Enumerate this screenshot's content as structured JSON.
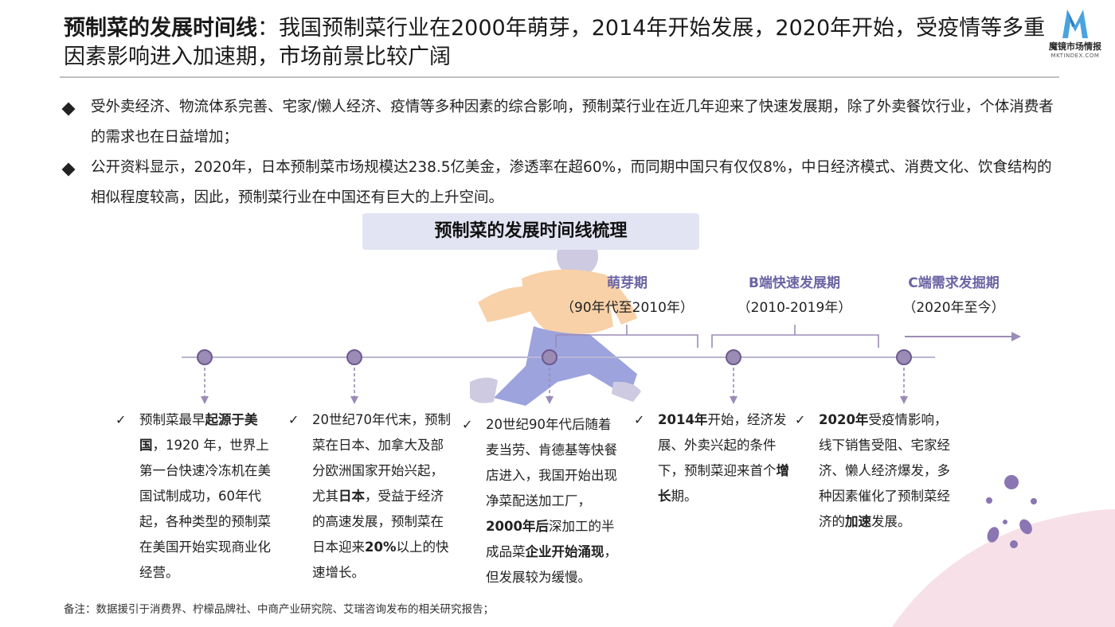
{
  "title": {
    "bold": "预制菜的发展时间线",
    "colon": "：",
    "rest": "我国预制菜行业在2000年萌芽，2014年开始发展，2020年开始，受疫情等多重因素影响进入加速期，市场前景比较广阔"
  },
  "logo": {
    "name": "魔镜市场情报",
    "sub": "MKTINDEX.COM"
  },
  "bullets": [
    {
      "text": "受外卖经济、物流体系完善、宅家/懒人经济、疫情等多种因素的综合影响，预制菜行业在近几年迎来了快速发展期，除了外卖餐饮行业，个体消费者的需求也在日益增加；"
    },
    {
      "text": "公开资料显示，2020年，日本预制菜市场规模达238.5亿美金，渗透率在超60%，而同期中国只有仅仅8%，中日经济模式、消费文化、饮食结构的相似程度较高，因此，预制菜行业在中国还有巨大的上升空间。"
    }
  ],
  "timeline_header": "预制菜的发展时间线梳理",
  "phases": [
    {
      "name": "萌芽期",
      "period": "（90年代至2010年）"
    },
    {
      "name": "B端快速发展期",
      "period": "（2010-2019年）"
    },
    {
      "name": "C端需求发掘期",
      "period": "（2020年至今）"
    }
  ],
  "cards": [
    {
      "check": "✓",
      "parts": [
        {
          "t": "预制菜最早",
          "b": false
        },
        {
          "t": "起源于美国",
          "b": true
        },
        {
          "t": "，1920 年，世界上第一台快速冷冻机在美国试制成功，60年代起，各种类型的预制菜在美国开始实现商业化经营。",
          "b": false
        }
      ]
    },
    {
      "check": "✓",
      "parts": [
        {
          "t": "20世纪70年代末，预制菜在日本、加拿大及部分欧洲国家开始兴起，尤其",
          "b": false
        },
        {
          "t": "日本",
          "b": true
        },
        {
          "t": "，受益于经济的高速发展，预制菜在日本迎来",
          "b": false
        },
        {
          "t": "20%",
          "b": true
        },
        {
          "t": "以上的快速增长。",
          "b": false
        }
      ]
    },
    {
      "check": "✓",
      "parts": [
        {
          "t": "20世纪90年代后随着麦当劳、肯德基等快餐店进入，我国开始出现净菜配送加工厂，",
          "b": false
        },
        {
          "t": "2000年后",
          "b": true
        },
        {
          "t": "深加工的半成品菜",
          "b": false
        },
        {
          "t": "企业开始涌现",
          "b": true
        },
        {
          "t": "，但发展较为缓慢。",
          "b": false
        }
      ]
    },
    {
      "check": "✓",
      "parts": [
        {
          "t": "2014年",
          "b": true
        },
        {
          "t": "开始，经济发展、外卖兴起的条件下，预制菜迎来首个",
          "b": false
        },
        {
          "t": "增长",
          "b": true
        },
        {
          "t": "期。",
          "b": false
        }
      ]
    },
    {
      "check": "✓",
      "parts": [
        {
          "t": "2020年",
          "b": true
        },
        {
          "t": "受疫情影响，线下销售受阻、宅家经济、懒人经济爆发，多种因素催化了预制菜经济的",
          "b": false
        },
        {
          "t": "加速",
          "b": true
        },
        {
          "t": "发展。",
          "b": false
        }
      ]
    }
  ],
  "footnote": "备注：数据援引于消费界、柠檬品牌社、中商产业研究院、艾瑞咨询发布的相关研究报告；",
  "colors": {
    "accent": "#6b64a4",
    "node": "#9b8cb6",
    "header_bg": "#e3e4f3",
    "line": "#b9b6d4"
  }
}
